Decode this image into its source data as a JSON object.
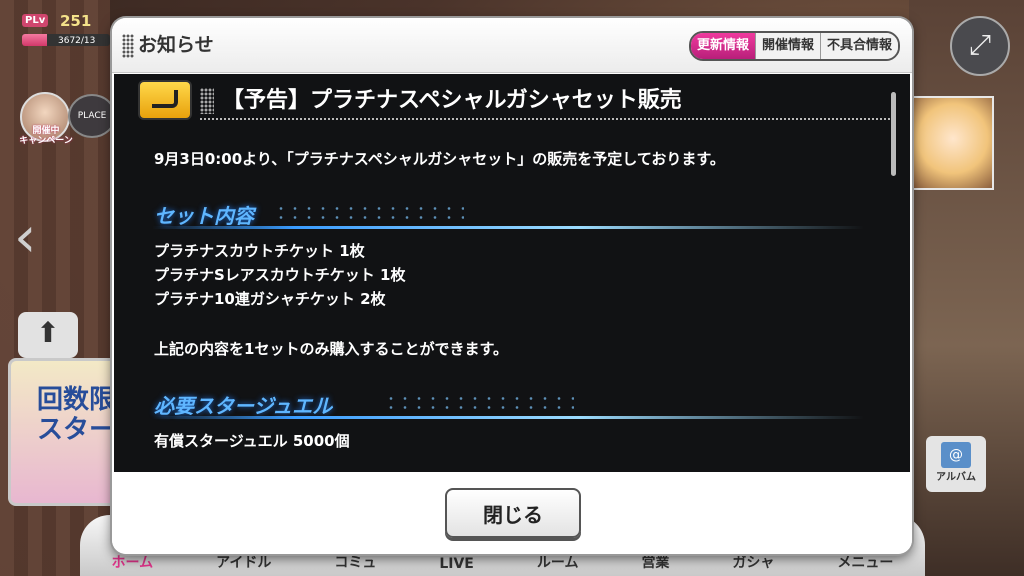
{
  "hud": {
    "plv_badge": "PLv",
    "level": "251",
    "exp": "3672/13",
    "exp_progress": 0.28,
    "campaign": "開催中\nキャンペーン",
    "place": "PLACE",
    "promo_text": "回数限\nスター"
  },
  "album": {
    "label": "アルバム"
  },
  "nav": {
    "items": [
      "ホーム",
      "アイドル",
      "コミュ",
      "LIVE",
      "ルーム",
      "営業",
      "ガシャ",
      "メニュー"
    ],
    "active_index": 0
  },
  "modal": {
    "title": "お知らせ",
    "tabs": [
      {
        "label": "更新情報",
        "active": true
      },
      {
        "label": "開催情報",
        "active": false
      },
      {
        "label": "不具合情報",
        "active": false
      }
    ],
    "news_title": "【予告】プラチナスペシャルガシャセット販売",
    "intro": "9月3日0:00より、「プラチナスペシャルガシャセット」の販売を予定しております。",
    "section1": {
      "heading": "セット内容",
      "lines": [
        "プラチナスカウトチケット 1枚",
        "プラチナSレアスカウトチケット 1枚",
        "プラチナ10連ガシャチケット 2枚"
      ],
      "note": "上記の内容を1セットのみ購入することができます。"
    },
    "section2": {
      "heading": "必要スタージュエル",
      "lines": [
        "有償スタージュエル 5000個"
      ]
    },
    "close_label": "閉じる"
  },
  "colors": {
    "accent": "#e0338a",
    "section_heading": "#5fb6ff"
  }
}
